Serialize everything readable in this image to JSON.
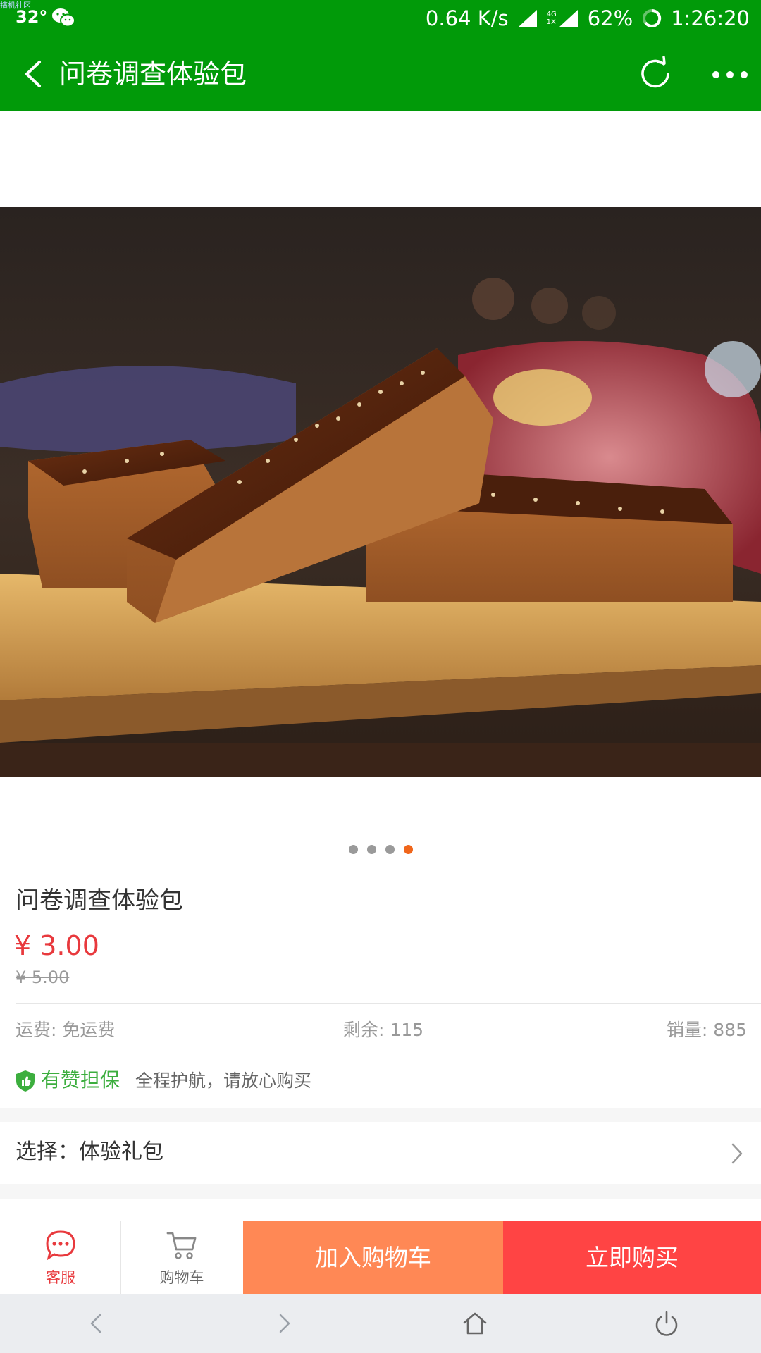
{
  "status_bar": {
    "watermark": "搞机社区",
    "temperature": "32°",
    "network_speed": "0.64 K/s",
    "net_type_top": "4G",
    "net_type_bottom": "1X",
    "battery": "62%",
    "time": "1:26:20"
  },
  "app_bar": {
    "title": "问卷调查体验包"
  },
  "carousel": {
    "total_slides": 4,
    "active_index": 3
  },
  "product": {
    "name": "问卷调查体验包",
    "price": "¥ 3.00",
    "original_price": "¥ 5.00",
    "shipping": "运费: 免运费",
    "remaining": "剩余: 115",
    "sales": "销量: 885",
    "guarantee_label": "有赞担保",
    "guarantee_text": "全程护航，请放心购买",
    "selection": "选择：体验礼包"
  },
  "actions": {
    "service_label": "客服",
    "cart_label": "购物车",
    "add_to_cart": "加入购物车",
    "buy_now": "立即购买"
  },
  "colors": {
    "header_green": "#019a09",
    "price_red": "#e8393d",
    "add_cart_orange": "#ff8855",
    "buy_red": "#ff4444",
    "guarantee_green": "#3cae3e",
    "dot_active": "#f0661b"
  }
}
